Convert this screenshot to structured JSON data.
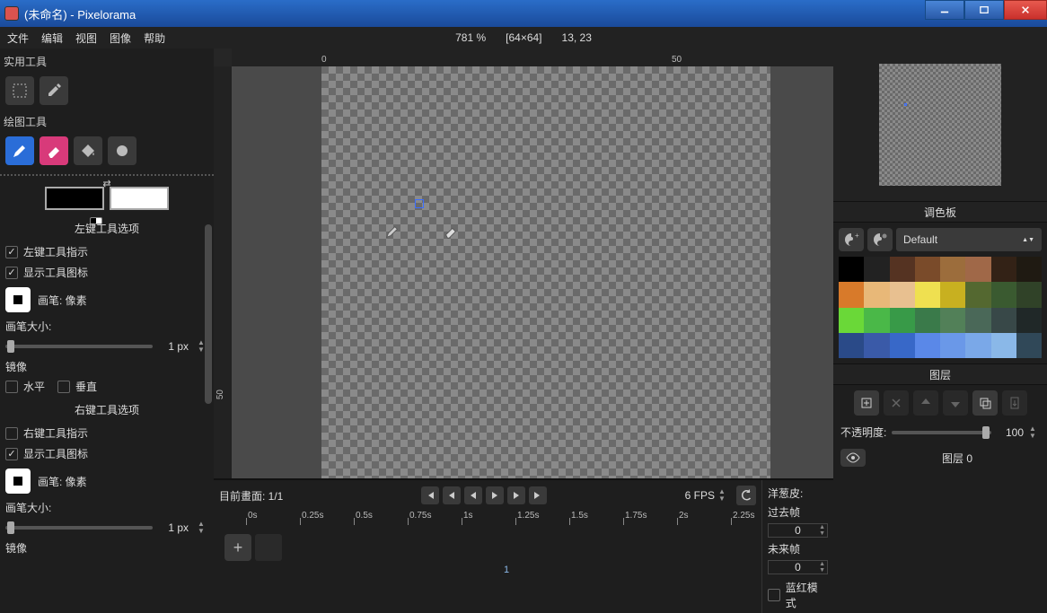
{
  "title": "(未命名) - Pixelorama",
  "menus": [
    "文件",
    "编辑",
    "视图",
    "图像",
    "帮助"
  ],
  "zoom": "781 %",
  "dimensions": "[64×64]",
  "cursor_pos": "13, 23",
  "left": {
    "utility_tools": "实用工具",
    "draw_tools": "绘图工具",
    "left_options_header": "左键工具选项",
    "right_options_header": "右键工具选项",
    "tool_hint": "左键工具指示",
    "tool_hint_r": "右键工具指示",
    "show_icon": "显示工具图标",
    "brush_label": "画笔: 像素",
    "brush_size": "画笔大小:",
    "brush_size_val": "1 px",
    "mirror": "镜像",
    "horiz": "水平",
    "vert": "垂直"
  },
  "timeline": {
    "current_frame": "目前畫面: 1/1",
    "fps": "6 FPS",
    "frame_num": "1",
    "ticks": [
      "0s",
      "0.25s",
      "0.5s",
      "0.75s",
      "1s",
      "1.25s",
      "1.5s",
      "1.75s",
      "2s",
      "2.25s"
    ]
  },
  "onion": {
    "title": "洋葱皮:",
    "past": "过去帧",
    "past_val": "0",
    "future": "未来帧",
    "future_val": "0",
    "blue_red": "蓝红模式"
  },
  "right": {
    "palette_header": "调色板",
    "palette_name": "Default",
    "layers_header": "图层",
    "opacity_label": "不透明度:",
    "opacity_val": "100",
    "layer0": "图层 0"
  },
  "palette": [
    "#000000",
    "#222222",
    "#553322",
    "#7a4b2a",
    "#9c6d3c",
    "#a06848",
    "#332216",
    "#1f1a12",
    "#d87a2a",
    "#e8b878",
    "#e8c090",
    "#efe050",
    "#c8b020",
    "#546830",
    "#3a5a30",
    "#304228",
    "#6ad838",
    "#4ab848",
    "#389a48",
    "#3a7a4a",
    "#528058",
    "#4a6858",
    "#384848",
    "#202828",
    "#2a4a88",
    "#3a5aa8",
    "#3868c8",
    "#5a88e8",
    "#6a98e8",
    "#7aa8e8",
    "#8ab8e8",
    "#304858"
  ]
}
